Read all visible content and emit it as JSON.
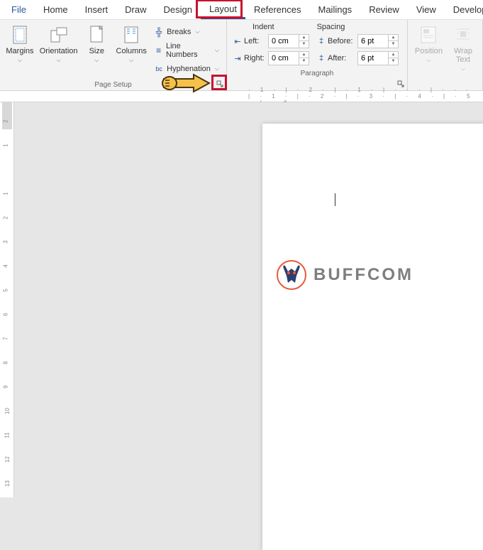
{
  "tabs": {
    "file": "File",
    "items": [
      "Home",
      "Insert",
      "Draw",
      "Design",
      "Layout",
      "References",
      "Mailings",
      "Review",
      "View",
      "Developer"
    ],
    "active": "Layout"
  },
  "ribbon": {
    "page_setup": {
      "margins": "Margins",
      "orientation": "Orientation",
      "size": "Size",
      "columns": "Columns",
      "breaks": "Breaks",
      "line_numbers": "Line Numbers",
      "hyphenation": "Hyphenation",
      "group_label": "Page Setup"
    },
    "paragraph": {
      "indent_label": "Indent",
      "spacing_label": "Spacing",
      "left_label": "Left:",
      "right_label": "Right:",
      "before_label": "Before:",
      "after_label": "After:",
      "left_value": "0 cm",
      "right_value": "0 cm",
      "before_value": "6 pt",
      "after_value": "6 pt",
      "group_label": "Paragraph"
    },
    "arrange": {
      "position": "Position",
      "wrap_text": "Wrap\nText"
    }
  },
  "ruler": {
    "corner": "⌐",
    "h_start": "3",
    "h_ticks": "· 1 · | · 2 · | · 1 · | · · · | · · · | · 1 · | · 2 · | · 3 · | · 4 · | · 5 · | · 6"
  },
  "watermark": "BUFFCOM"
}
